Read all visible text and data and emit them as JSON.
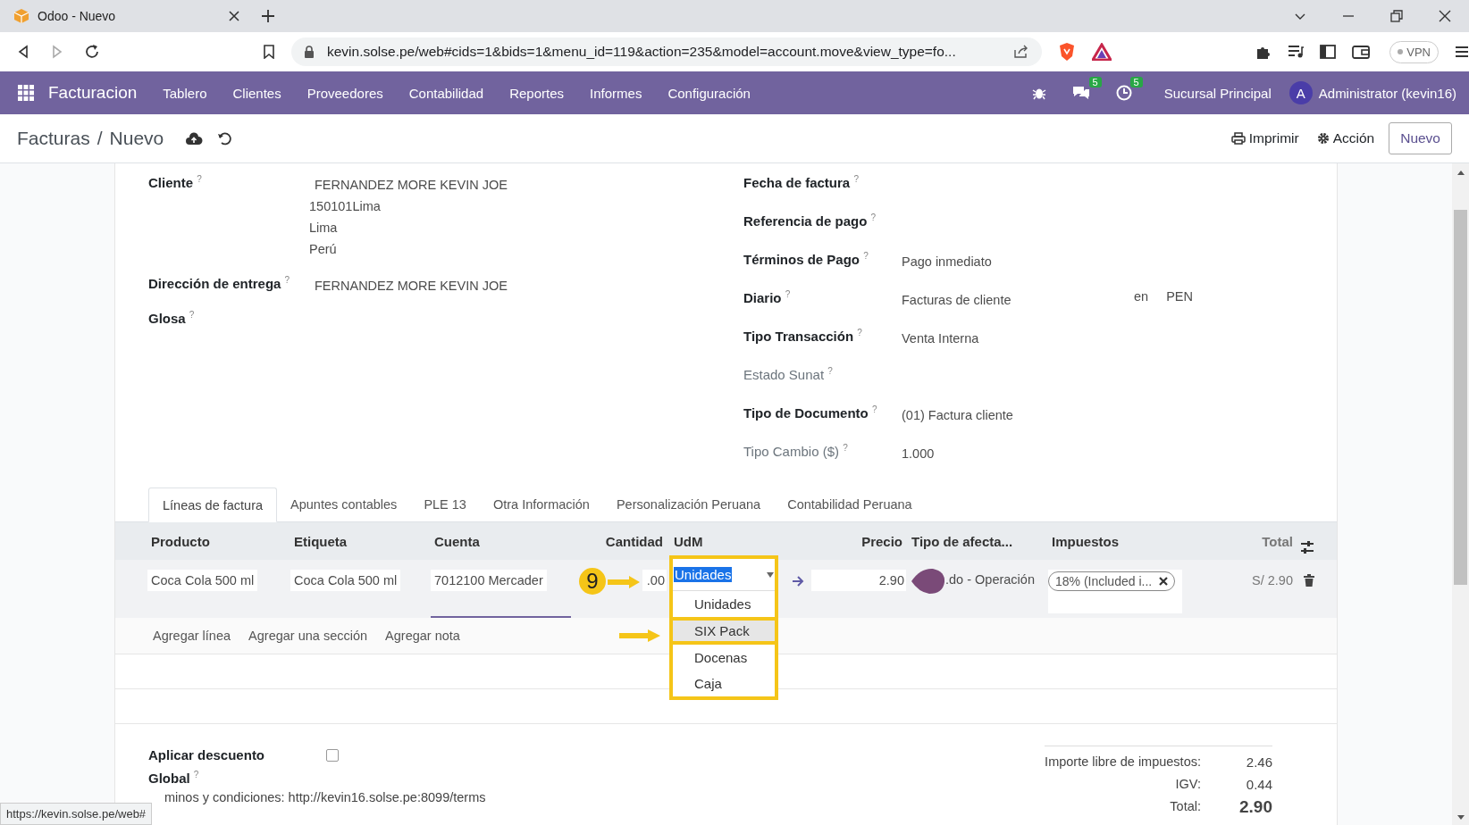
{
  "browser": {
    "tab_title": "Odoo - Nuevo",
    "url": "kevin.solse.pe/web#cids=1&bids=1&menu_id=119&action=235&model=account.move&view_type=fo...",
    "vpn": "VPN",
    "status_url": "https://kevin.solse.pe/web#"
  },
  "navbar": {
    "app": "Facturacion",
    "menu": [
      "Tablero",
      "Clientes",
      "Proveedores",
      "Contabilidad",
      "Reportes",
      "Informes",
      "Configuración"
    ],
    "messages_badge": "5",
    "activities_badge": "5",
    "company": "Sucursal Principal",
    "avatar": "A",
    "user": "Administrator (kevin16)"
  },
  "control_panel": {
    "breadcrumb": [
      "Facturas",
      "Nuevo"
    ],
    "separator": "/",
    "actions": [
      {
        "kind": "print",
        "label": "Imprimir"
      },
      {
        "kind": "gear",
        "label": "Acción"
      }
    ],
    "new_button": "Nuevo"
  },
  "form": {
    "left": [
      {
        "label": "Cliente $^{?}$",
        "lines": [
          "FERNANDEZ MORE KEVIN JOE",
          "150101Lima",
          "Lima",
          "Perú"
        ]
      },
      {
        "label": "Dirección de entrega $^{?}$",
        "lines": [
          "FERNANDEZ MORE KEVIN JOE"
        ]
      },
      {
        "label": "Glosa $^{?}$"
      }
    ],
    "right": [
      {
        "label": "Fecha de factura $^{?}$",
        "muted": false
      },
      {
        "label": "Referencia de pago $^{?}$",
        "muted": false
      },
      {
        "label": "Términos de Pago $^{?}$",
        "muted": false,
        "value": "Pago inmediato"
      },
      {
        "label": "Diario $^{?}$",
        "muted": false,
        "value": "Facturas de cliente",
        "extra": [
          "en",
          "PEN"
        ]
      },
      {
        "label": "Tipo Transacción $^{?}$",
        "muted": false,
        "value": "Venta Interna"
      },
      {
        "label": "Estado Sunat $^{?}$",
        "muted": true
      },
      {
        "label": "Tipo de Documento $^{?}$",
        "muted": false,
        "value": "(01) Factura cliente"
      },
      {
        "label": "Tipo Cambio ($) $^{?}$",
        "muted": true,
        "value": "1.000"
      }
    ]
  },
  "tabs": [
    {
      "label": "Líneas de factura",
      "selected": true
    },
    {
      "label": "Apuntes contables",
      "selected": false
    },
    {
      "label": "PLE 13",
      "selected": false
    },
    {
      "label": "Otra Información",
      "selected": false
    },
    {
      "label": "Personalización Peruana",
      "selected": false
    },
    {
      "label": "Contabilidad Peruana",
      "selected": false
    }
  ],
  "lines_table": {
    "columns": [
      "Producto",
      "Etiqueta",
      "Cuenta",
      "Cantidad",
      "UdM",
      "Precio",
      "Tipo de afecta...",
      "Impuestos",
      "Total"
    ],
    "row": {
      "product": "Coca Cola 500 ml",
      "label": "Coca Cola 500 ml",
      "account": "7012100 Mercader",
      "quantity": ".00",
      "uom": "Unidades",
      "price": "2.90",
      "affectation": ".do - Operación",
      "tax_tag": "18% (Included i...",
      "total": "S/ 2.90"
    },
    "uom_options": [
      {
        "label": "Unidades",
        "selected": false
      },
      {
        "label": "SIX Pack",
        "selected": true
      },
      {
        "label": "Docenas",
        "selected": false
      },
      {
        "label": "Caja",
        "selected": false
      }
    ],
    "add_links": [
      "Agregar línea",
      "Agregar una sección",
      "Agregar nota"
    ]
  },
  "annotation": {
    "step": "9"
  },
  "footer": {
    "discount": {
      "label": "Aplicar descuento Global $^{?}$",
      "checked": false
    },
    "terms": "minos y condiciones: http://kevin16.solse.pe:8099/terms",
    "totals": [
      {
        "label": "Importe libre de impuestos:",
        "value": "2.46",
        "kind": "normal"
      },
      {
        "label": "IGV:",
        "value": "0.44",
        "kind": "normal"
      },
      {
        "label": "Total:",
        "value": "2.90",
        "kind": "grand"
      }
    ]
  }
}
